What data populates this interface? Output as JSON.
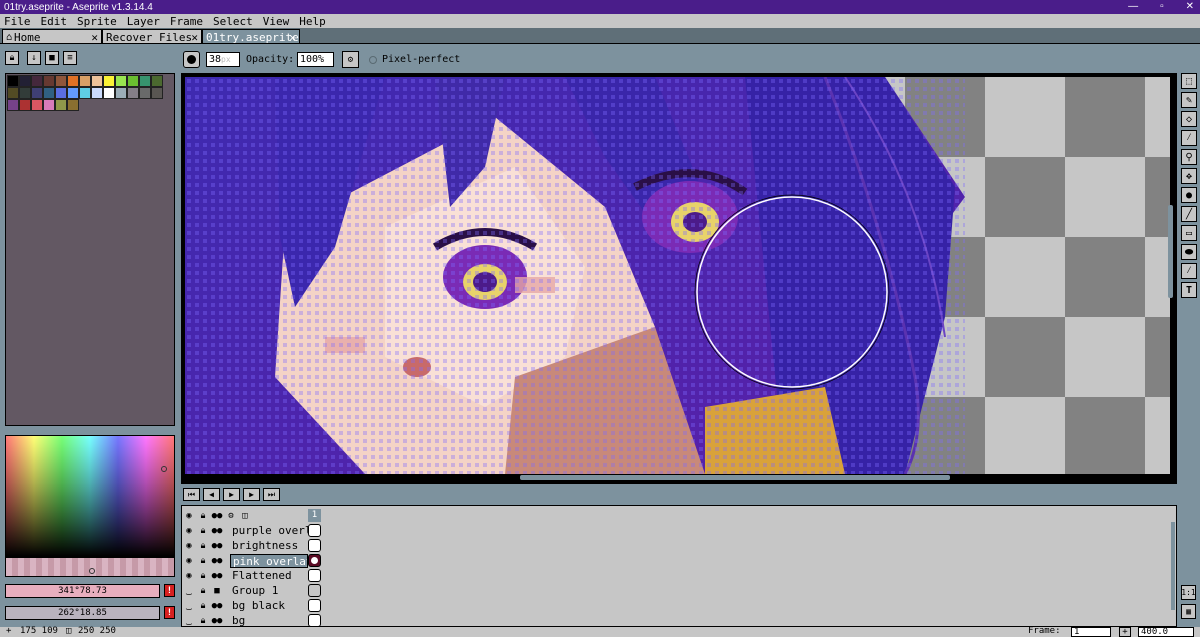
{
  "window": {
    "title": "01try.aseprite - Aseprite v1.3.14.4",
    "minimize": "—",
    "maximize": "▫",
    "close": "✕"
  },
  "menu": [
    "File",
    "Edit",
    "Sprite",
    "Layer",
    "Frame",
    "Select",
    "View",
    "Help"
  ],
  "tabs": [
    {
      "label": "Home",
      "close": "✕"
    },
    {
      "label": "Recover Files",
      "close": "✕"
    },
    {
      "label": "01try.aseprite",
      "close": "✕"
    }
  ],
  "context_bar": {
    "brush_size": "38",
    "brush_unit": "px",
    "opacity_label": "Opacity:",
    "opacity_value": "100%",
    "pixel_perfect_label": "Pixel-perfect"
  },
  "palette": {
    "swatches": [
      "#000000",
      "#222034",
      "#45283c",
      "#663931",
      "#8f563b",
      "#df7126",
      "#d9a066",
      "#eec39a",
      "#fbf236",
      "#99e550",
      "#6abe30",
      "#37946e",
      "#4b692f",
      "#524b24",
      "#323c39",
      "#3f3f74",
      "#306082",
      "#5b6ee1",
      "#639bff",
      "#5fcde4",
      "#cbdbfc",
      "#ffffff",
      "#9badb7",
      "#847e87",
      "#696a6a",
      "#595652",
      "#76428a",
      "#ac3232",
      "#d95763",
      "#d77bba",
      "#8f974a",
      "#8a6f30"
    ]
  },
  "colors": {
    "foreground_label": "341°78.73",
    "foreground_color": "#e8aebe",
    "background_label": "262°18.85",
    "background_color": "#b9b3be",
    "warning": "!",
    "accent": "#4a1d8a",
    "panel": "#c6c6c6",
    "ui_bg": "#7d929e"
  },
  "timeline": {
    "frame_column": "1",
    "layers": [
      {
        "name": "purple overlay",
        "icon": "eye-icon"
      },
      {
        "name": "brightness",
        "icon": "eye-icon"
      },
      {
        "name": "pink overlay",
        "icon": "eye-icon",
        "active": true
      },
      {
        "name": "Flattened",
        "icon": "eye-icon"
      },
      {
        "name": "Group 1",
        "icon": "folder-icon"
      },
      {
        "name": "bg black",
        "icon": "closed-eye-icon"
      },
      {
        "name": "bg",
        "icon": "closed-eye-icon"
      }
    ]
  },
  "side_buttons": {
    "zoom_reset": "1:1",
    "layout": "▦"
  },
  "status": {
    "position": "175 109",
    "size": "250 250",
    "frame_label": "Frame:",
    "frame_value": "1",
    "zoom_value": "400.0"
  }
}
